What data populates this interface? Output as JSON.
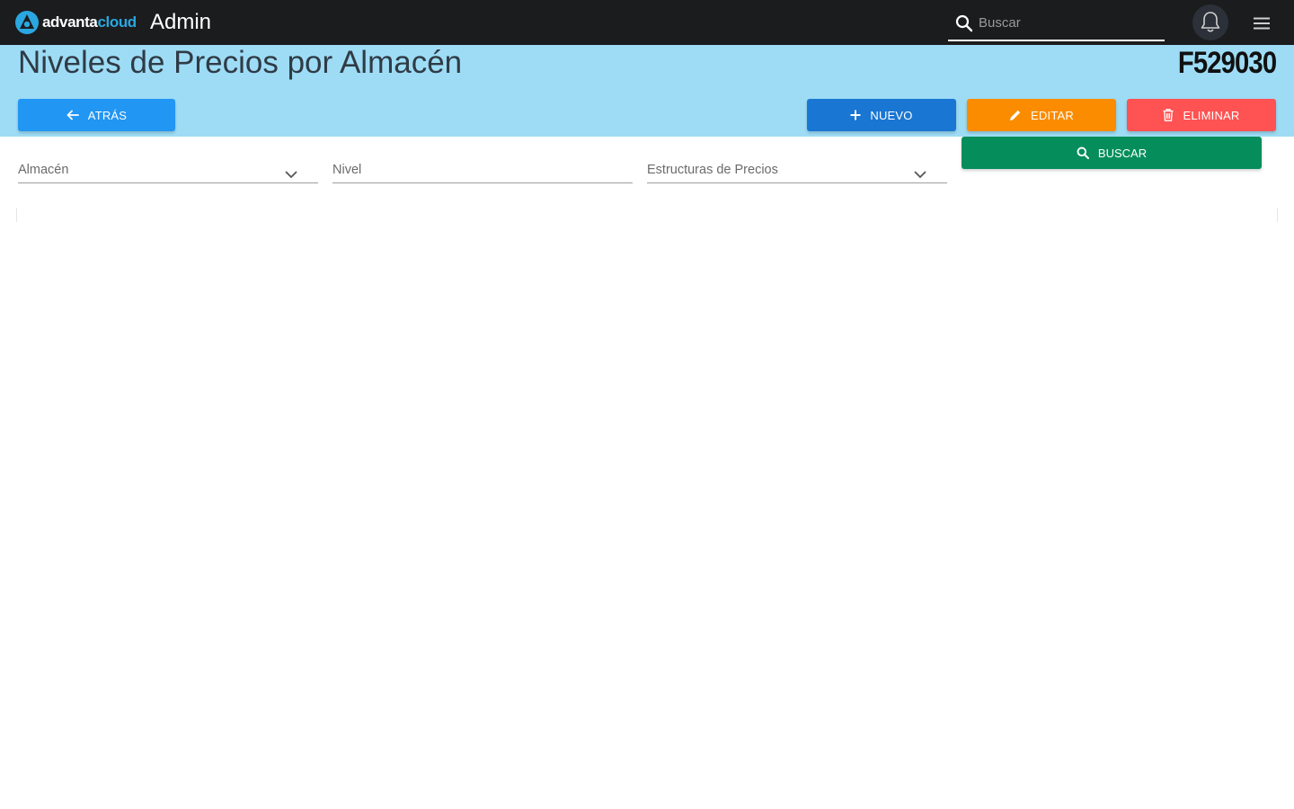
{
  "topbar": {
    "logo_text_1": "advanta",
    "logo_text_2": "cloud",
    "app_name": "Admin",
    "search_placeholder": "Buscar",
    "icons": [
      "logo-icon",
      "search-icon",
      "bell-icon",
      "hamburger-menu-icon"
    ]
  },
  "header": {
    "title": "Niveles de Precios por Almacén",
    "code": "F529030"
  },
  "actions": {
    "back_label": "ATRÁS",
    "new_label": "NUEVO",
    "edit_label": "EDITAR",
    "delete_label": "ELIMINAR",
    "search_label": "BUSCAR"
  },
  "filters": {
    "almacen_label": "Almacén",
    "nivel_label": "Nivel",
    "estructuras_label": "Estructuras de Precios"
  },
  "colors": {
    "topbar": "#1b1c1e",
    "header_band": "#9edcf6",
    "back": "#2196f3",
    "new": "#1976d2",
    "edit": "#fb8c00",
    "delete": "#ff5252",
    "search": "#058e5b",
    "brand_accent": "#2aa7e0"
  }
}
